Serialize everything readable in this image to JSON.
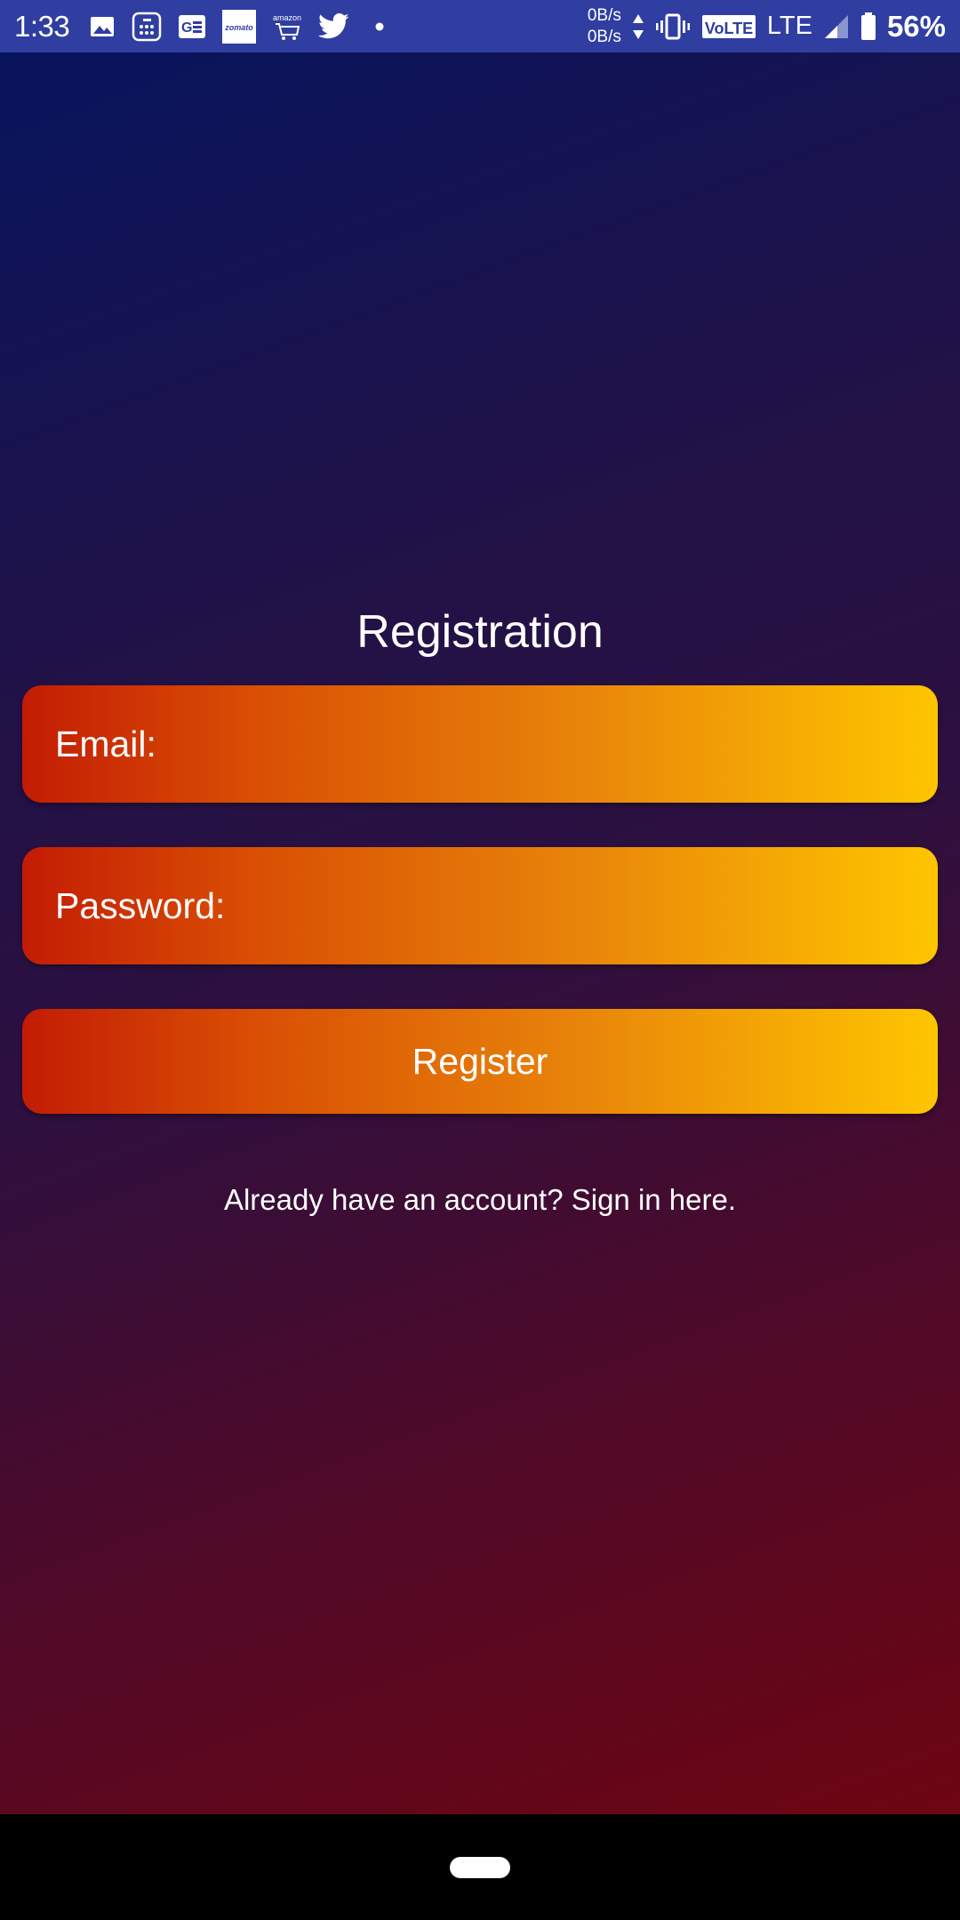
{
  "status_bar": {
    "time": "1:33",
    "net_up": "0B/s",
    "net_down": "0B/s",
    "volte": "VoLTE",
    "network": "LTE",
    "battery": "56%",
    "icons": [
      "gallery-icon",
      "calculator-icon",
      "google-news-icon",
      "zomato-icon",
      "amazon-icon",
      "twitter-icon",
      "notification-dot-icon",
      "data-arrows-icon",
      "vibrate-icon",
      "volte-icon",
      "signal-icon",
      "battery-icon"
    ],
    "zomato_label": "zomato",
    "amazon_label": "amazon"
  },
  "form": {
    "title": "Registration",
    "email_label": "Email:",
    "password_label": "Password:",
    "register_label": "Register",
    "signin_text": "Already have an account? Sign in here."
  },
  "colors": {
    "status_bar": "#2f3ea0",
    "bg_top": "#08145e",
    "bg_bottom": "#6e0512",
    "field_start": "#c31c04",
    "field_end": "#ffc500",
    "nav_bar": "#000000"
  }
}
